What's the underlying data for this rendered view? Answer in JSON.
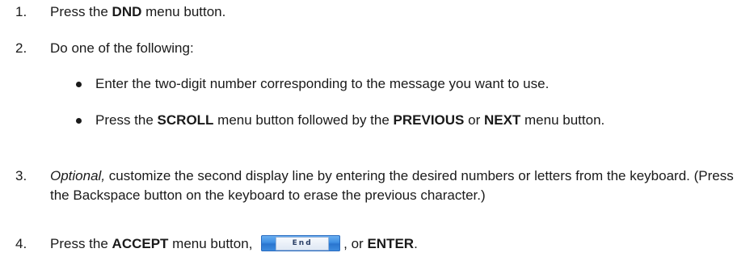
{
  "steps": [
    {
      "number": "1.",
      "parts": [
        "Press the ",
        "DND",
        " menu button."
      ]
    },
    {
      "number": "2.",
      "text": "Do one of the following:",
      "bullets": [
        {
          "text": "Enter the two-digit number corresponding to the message you want to use."
        },
        {
          "parts": [
            "Press the ",
            "SCROLL",
            " menu button followed by the ",
            "PREVIOUS",
            " or ",
            "NEXT",
            " menu button."
          ]
        }
      ]
    },
    {
      "number": "3.",
      "parts": [
        "Optional,",
        " customize the second display line by entering the desired numbers or letters from the keyboard. (Press the Backspace button on the keyboard to erase the previous character.)"
      ]
    },
    {
      "number": "4.",
      "parts": [
        "Press the ",
        "ACCEPT",
        " menu button, ",
        "End",
        ", or ",
        "ENTER",
        "."
      ]
    }
  ]
}
